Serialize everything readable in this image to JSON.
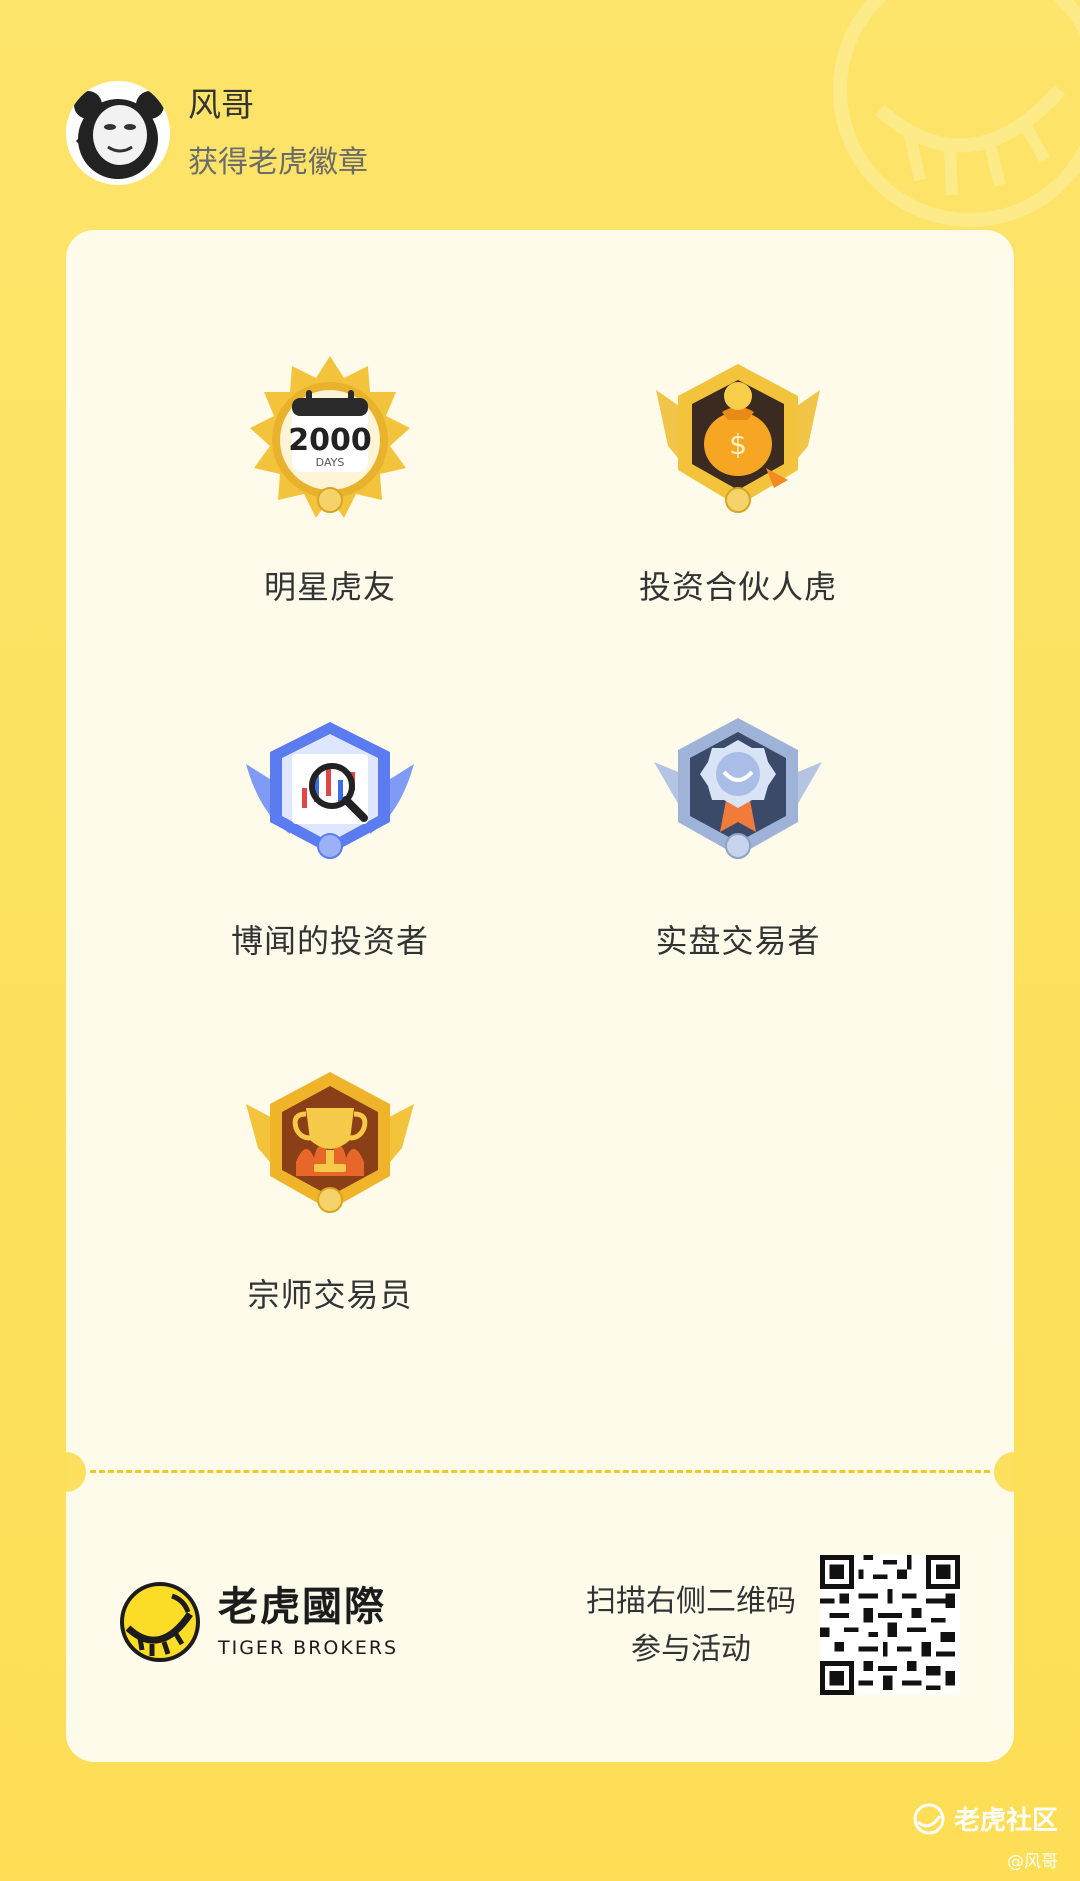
{
  "header": {
    "user_name": "风哥",
    "subtitle": "获得老虎徽章"
  },
  "badges": [
    {
      "label": "明星虎友",
      "icon": "calendar-2000-days-badge-icon",
      "badge_text": "2000",
      "badge_sub": "DAYS"
    },
    {
      "label": "投资合伙人虎",
      "icon": "money-bag-badge-icon"
    },
    {
      "label": "博闻的投资者",
      "icon": "chart-magnifier-badge-icon"
    },
    {
      "label": "实盘交易者",
      "icon": "medal-badge-icon"
    },
    {
      "label": "宗师交易员",
      "icon": "trophy-badge-icon"
    }
  ],
  "footer": {
    "brand_cn": "老虎國際",
    "brand_en": "TIGER BROKERS",
    "scan_line1": "扫描右侧二维码",
    "scan_line2": "参与活动"
  },
  "watermark": {
    "site": "老虎社区",
    "user": "@风哥"
  },
  "colors": {
    "background": "#fde15e",
    "card": "#fefbeb",
    "divider": "#f0c925",
    "gold": "#f3c43b",
    "blue": "#5b7cf0",
    "silver": "#9fb3d8"
  }
}
